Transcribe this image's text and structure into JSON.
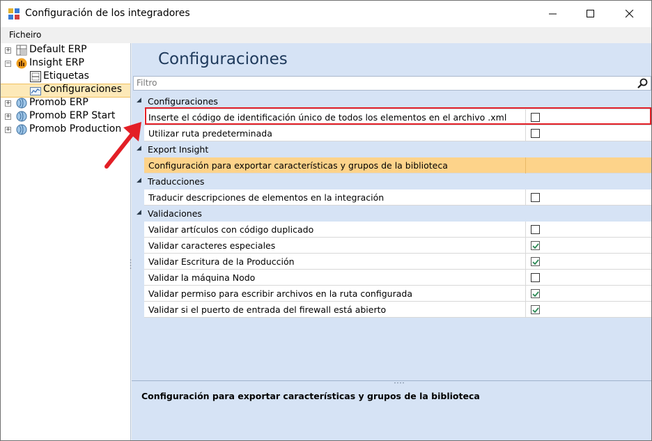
{
  "window": {
    "title": "Configuración de los integradores"
  },
  "menu": {
    "items": [
      "Ficheiro"
    ]
  },
  "tree": {
    "nodes": [
      {
        "label": "Default ERP",
        "expander": "+",
        "icon": "erp-grid-icon"
      },
      {
        "label": "Insight ERP",
        "expander": "−",
        "icon": "insight-factory-icon"
      },
      {
        "label": "Etiquetas",
        "icon": "label-icon"
      },
      {
        "label": "Configuraciones",
        "icon": "chart-config-icon",
        "selected": true
      },
      {
        "label": "Promob ERP",
        "expander": "+",
        "icon": "promob-globe-icon"
      },
      {
        "label": "Promob ERP Start",
        "expander": "+",
        "icon": "promob-globe-icon"
      },
      {
        "label": "Promob Production",
        "expander": "+",
        "icon": "promob-globe-icon"
      }
    ]
  },
  "main": {
    "title": "Configuraciones",
    "filter_placeholder": "Filtro",
    "categories": [
      {
        "label": "Configuraciones",
        "rows": [
          {
            "label": "Inserte el código de identificación único de todos los elementos en el archivo .xml",
            "checked": false
          },
          {
            "label": "Utilizar ruta predeterminada",
            "checked": false
          }
        ]
      },
      {
        "label": "Export Insight",
        "rows": [
          {
            "label": "Configuración para exportar características y grupos de la biblioteca",
            "selected": true
          }
        ]
      },
      {
        "label": "Traducciones",
        "rows": [
          {
            "label": "Traducir descripciones de elementos en la integración",
            "checked": false
          }
        ]
      },
      {
        "label": "Validaciones",
        "rows": [
          {
            "label": "Validar artículos con código duplicado",
            "checked": false
          },
          {
            "label": "Validar caracteres especiales",
            "checked": true
          },
          {
            "label": "Validar Escritura de la Producción",
            "checked": true
          },
          {
            "label": "Validar la máquina Nodo",
            "checked": false
          },
          {
            "label": "Validar permiso para escribir archivos en la ruta configurada",
            "checked": true
          },
          {
            "label": "Validar si el puerto de entrada del firewall está abierto",
            "checked": true
          }
        ]
      }
    ],
    "description": "Configuración para exportar características y grupos de la biblioteca"
  },
  "colors": {
    "accent_selected": "#fdd38a",
    "panel": "#d6e3f5",
    "title": "#1e395b",
    "annotation": "#e31f26",
    "checkmark": "#2e8b57"
  }
}
